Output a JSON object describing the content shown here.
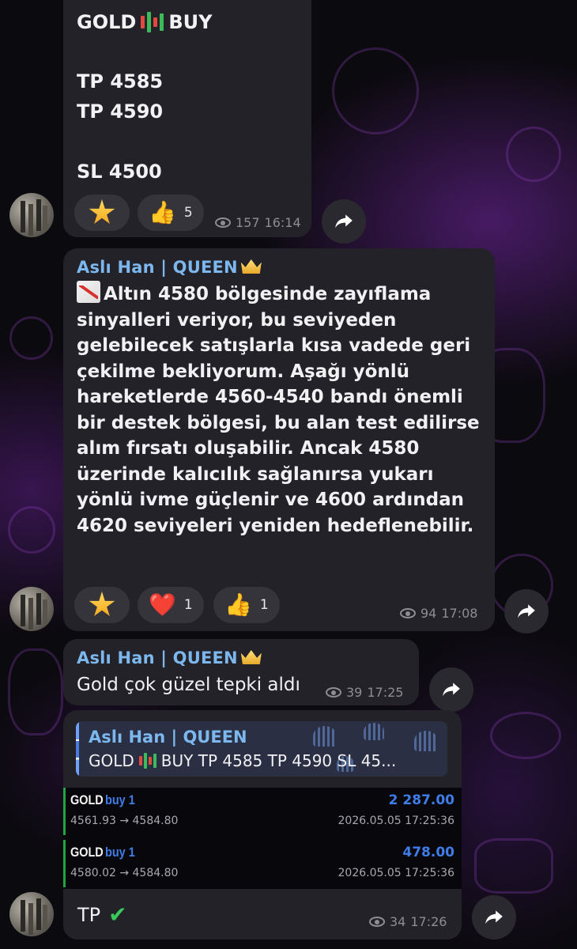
{
  "messages": {
    "m1": {
      "title_left": "GOLD",
      "title_right": "BUY",
      "tp1": "TP 4585",
      "tp2": "TP 4590",
      "sl": "SL 4500",
      "reactions": [
        {
          "emoji": "👍",
          "count": "5"
        }
      ],
      "views": "157",
      "time": "16:14"
    },
    "m2": {
      "sender": "Aslı Han | QUEEN",
      "text": "Altın 4580 bölgesinde zayıflama sinyalleri veriyor, bu seviyeden gelebilecek satışlarla kısa vadede geri çekilme bekliyorum. Aşağı yönlü hareketlerde 4560-4540 bandı önemli bir destek bölgesi, bu alan test edilirse alım fırsatı oluşabilir. Ancak 4580 üzerinde kalıcılık sağlanırsa yukarı yönlü ivme güçlenir ve 4600 ardından 4620 seviyeleri yeniden hedeflenebilir.",
      "reactions": [
        {
          "emoji": "❤️",
          "count": "1"
        },
        {
          "emoji": "👍",
          "count": "1"
        }
      ],
      "views": "94",
      "time": "17:08"
    },
    "m3": {
      "sender": "Aslı Han | QUEEN",
      "text": "Gold çok güzel tepki aldı",
      "views": "39",
      "time": "17:25"
    },
    "m4": {
      "reply_sender": "Aslı Han | QUEEN",
      "reply_text_left": "GOLD",
      "reply_text_right": "BUY TP 4585 TP 4590 SL 45...",
      "trades": [
        {
          "symbol": "GOLD",
          "side": "buy 1",
          "profit": "2 287.00",
          "prices": "4561.93 → 4584.80",
          "datetime": "2026.05.05 17:25:36"
        },
        {
          "symbol": "GOLD",
          "side": "buy 1",
          "profit": "478.00",
          "prices": "4580.02 → 4584.80",
          "datetime": "2026.05.05 17:25:36"
        }
      ],
      "text": "TP",
      "check": "✔",
      "views": "34",
      "time": "17:26"
    }
  },
  "colors": {
    "bubble": "#232228",
    "sender_name": "#7cb7ee",
    "profit_blue": "#3f7de8",
    "trade_bar_green": "#1fa544"
  }
}
